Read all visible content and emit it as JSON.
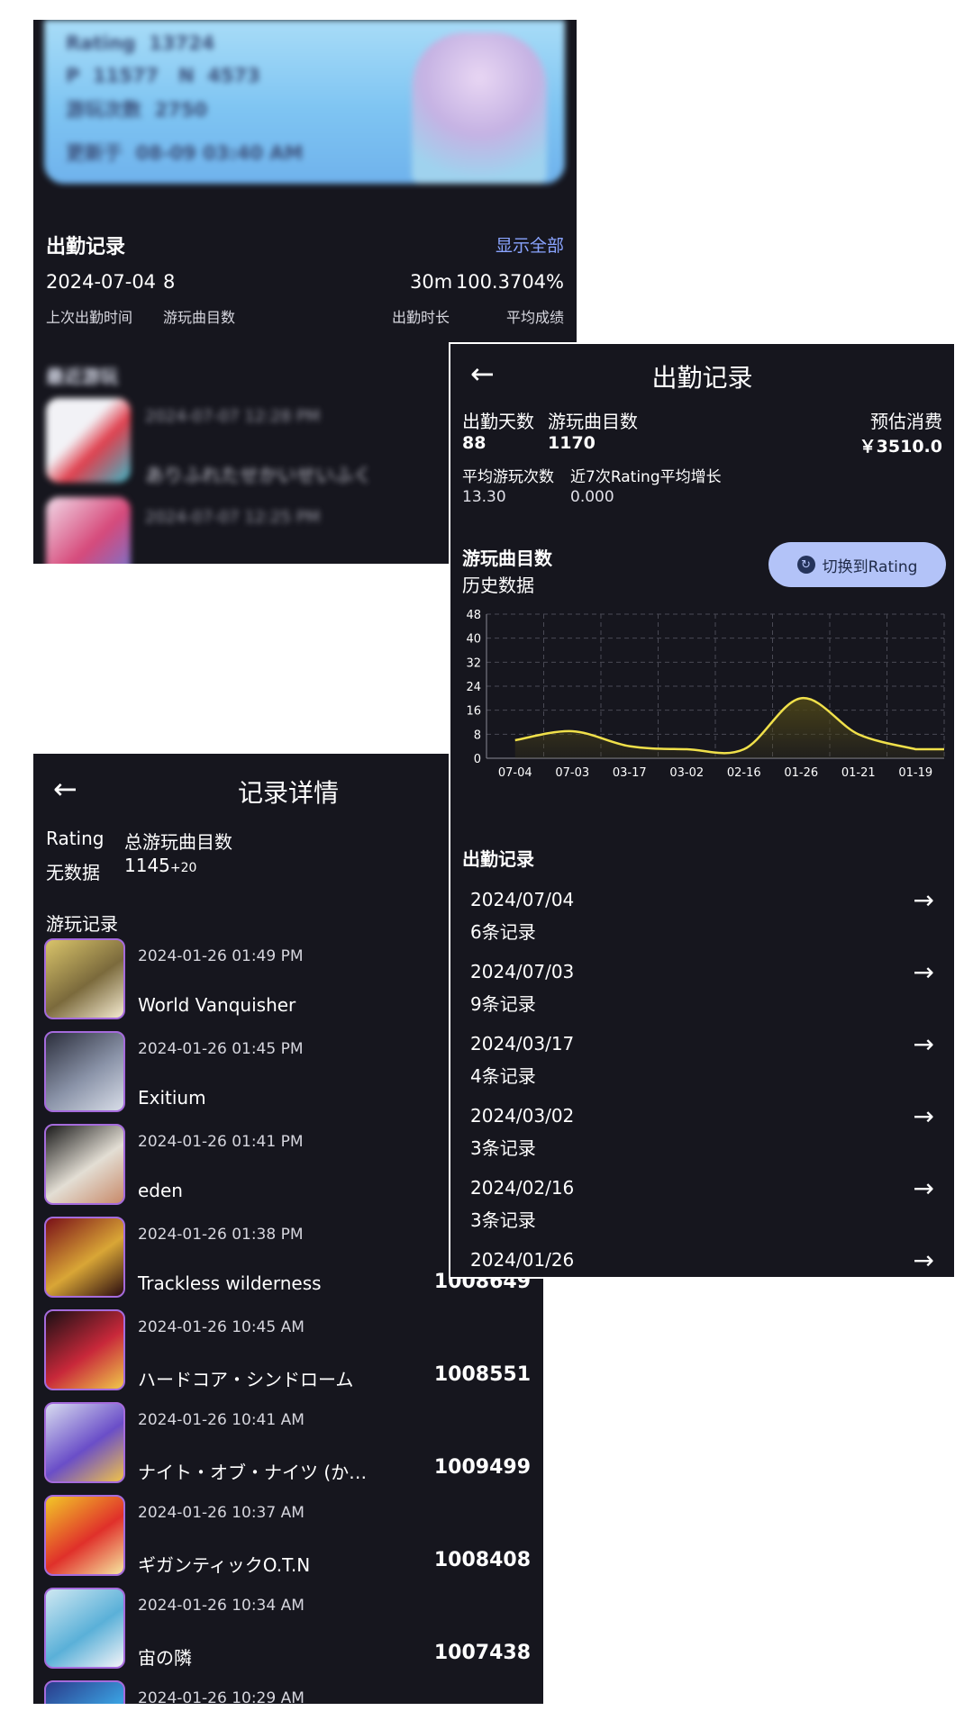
{
  "profile": {
    "rating_label": "Rating",
    "rating_value": "13724",
    "p_label": "P",
    "p_value": "11577",
    "n_label": "N",
    "n_value": "4573",
    "plays_label": "游玩次数",
    "plays_value": "2750",
    "updated_label": "更新于",
    "updated_value": "08-09 03:40 AM"
  },
  "attendance_summary": {
    "title": "出勤记录",
    "show_all": "显示全部",
    "last_date": "2024-07-04",
    "songs": "8",
    "duration": "30m",
    "avg_score": "100.3704%",
    "labels": {
      "last_date": "上次出勤时间",
      "songs": "游玩曲目数",
      "duration": "出勤时长",
      "avg_score": "平均成绩"
    }
  },
  "recent": {
    "title": "最近游玩",
    "items": [
      {
        "time": "2024-07-07 12:28 PM",
        "name": "ありふれたせかいせいふく",
        "thumb_colors": [
          "#f2f2f6",
          "#e0404e",
          "#3ab8c8"
        ]
      },
      {
        "time": "2024-07-07 12:25 PM",
        "name": "",
        "thumb_colors": [
          "#f2dcea",
          "#d6497a",
          "#6c7ad8"
        ]
      }
    ]
  },
  "record_detail": {
    "title": "记录详情",
    "rating_label": "Rating",
    "rating_value": "无数据",
    "total_label": "总游玩曲目数",
    "total_value": "1145",
    "total_extra": "+20",
    "history_title": "游玩记录",
    "items": [
      {
        "time": "2024-01-26 01:49 PM",
        "name": "World Vanquisher",
        "score": "",
        "colors": [
          "#d9c46a",
          "#7b6a3c",
          "#f4ead0"
        ]
      },
      {
        "time": "2024-01-26 01:45 PM",
        "name": "Exitium",
        "score": "",
        "colors": [
          "#2b2e3c",
          "#8a93a8",
          "#d8dde8"
        ]
      },
      {
        "time": "2024-01-26 01:41 PM",
        "name": "eden",
        "score": "",
        "colors": [
          "#1a1a1a",
          "#e3ded4",
          "#c88a6a"
        ]
      },
      {
        "time": "2024-01-26 01:38 PM",
        "name": "Trackless wilderness",
        "score": "1008649",
        "colors": [
          "#7a1018",
          "#d9a636",
          "#2a0c10"
        ]
      },
      {
        "time": "2024-01-26 10:45 AM",
        "name": "ハードコア・シンドローム",
        "score": "1008551",
        "colors": [
          "#1a1014",
          "#c8283a",
          "#f0c84a"
        ]
      },
      {
        "time": "2024-01-26 10:41 AM",
        "name": "ナイト・オブ・ナイツ (か…",
        "score": "1009499",
        "colors": [
          "#d8dcf0",
          "#6a4ec8",
          "#f0c24a"
        ]
      },
      {
        "time": "2024-01-26 10:37 AM",
        "name": "ギガンティックO.T.N",
        "score": "1008408",
        "colors": [
          "#f2c828",
          "#e0302a",
          "#f6e6a0"
        ]
      },
      {
        "time": "2024-01-26 10:34 AM",
        "name": "宙の隣",
        "score": "1007438",
        "colors": [
          "#cfe8f2",
          "#5ab0d8",
          "#f4f4f8"
        ]
      },
      {
        "time": "2024-01-26 10:29 AM",
        "name": "",
        "score": "",
        "colors": [
          "#2a3a8a",
          "#3aa0e0",
          "#10204a"
        ]
      }
    ]
  },
  "attendance_records": {
    "title": "出勤记录",
    "days_label": "出勤天数",
    "days_value": "88",
    "songs_label": "游玩曲目数",
    "songs_value": "1170",
    "cost_label": "预估消费",
    "cost_value": "￥3510.0",
    "avg_plays_label": "平均游玩次数",
    "avg_plays_value": "13.30",
    "rating_growth_label": "近7次Rating平均增长",
    "rating_growth_value": "0.000",
    "chart_title": "游玩曲目数",
    "chart_subtitle": "历史数据",
    "switch_label": "切换到Rating",
    "list_title": "出勤记录",
    "items": [
      {
        "date": "2024/07/04",
        "count": "6条记录"
      },
      {
        "date": "2024/07/03",
        "count": "9条记录"
      },
      {
        "date": "2024/03/17",
        "count": "4条记录"
      },
      {
        "date": "2024/03/02",
        "count": "3条记录"
      },
      {
        "date": "2024/02/16",
        "count": "3条记录"
      },
      {
        "date": "2024/01/26",
        "count": ""
      }
    ]
  },
  "chart_data": {
    "type": "area",
    "categories": [
      "07-04",
      "07-03",
      "03-17",
      "03-02",
      "02-16",
      "01-26",
      "01-21",
      "01-19"
    ],
    "series": [
      {
        "values": [
          6,
          9,
          4,
          3,
          3,
          20,
          8,
          3
        ]
      }
    ],
    "yticks": [
      0,
      8,
      16,
      24,
      32,
      40,
      48
    ],
    "ylim": [
      0,
      48
    ],
    "grid": true,
    "line_color": "#f0e04a",
    "fill_color": "#4a4318"
  },
  "colors": {
    "background": "#16161e",
    "accent_link": "#8aa4ff",
    "button_bg": "#b3c3f8",
    "cover_border": "#a56bdc"
  }
}
